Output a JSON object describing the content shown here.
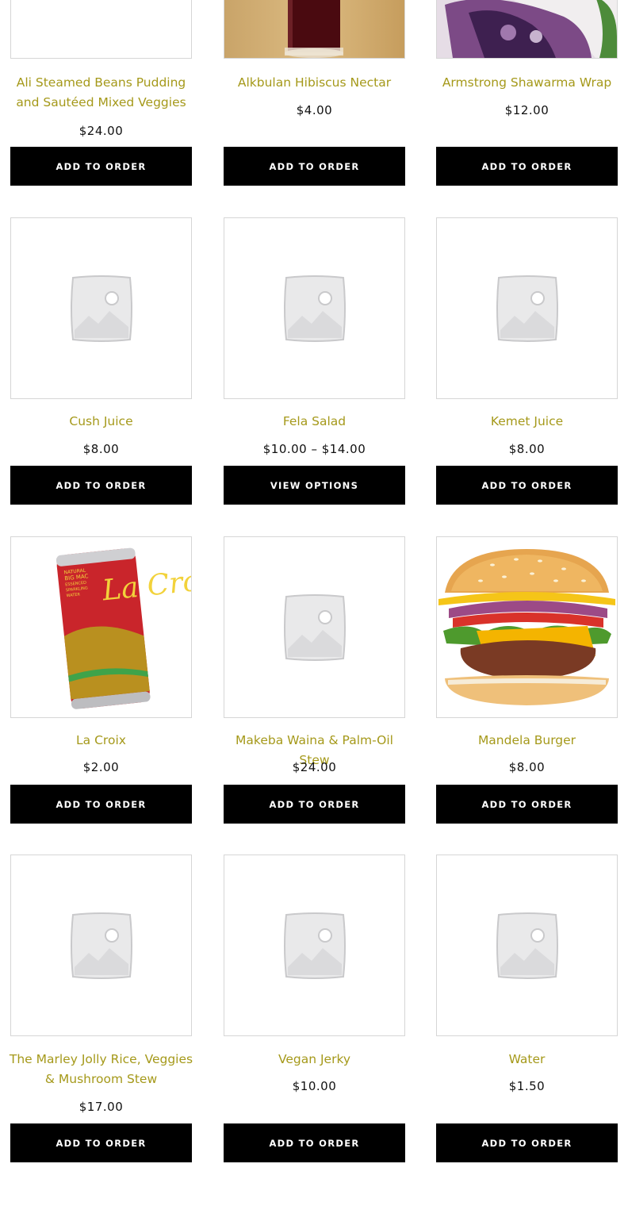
{
  "products": [
    {
      "name": "Ali Steamed Beans Pudding and Sautéed Mixed Veggies",
      "price": "$24.00",
      "button": "ADD TO ORDER",
      "image": "placeholder-image"
    },
    {
      "name": "Alkbulan Hibiscus Nectar",
      "price": "$4.00",
      "button": "ADD TO ORDER",
      "image": "glass-of-hibiscus-drink"
    },
    {
      "name": "Armstrong Shawarma Wrap",
      "price": "$12.00",
      "button": "ADD TO ORDER",
      "image": "wrap-photo"
    },
    {
      "name": "Cush Juice",
      "price": "$8.00",
      "button": "ADD TO ORDER",
      "image": "placeholder-image"
    },
    {
      "name": "Fela Salad",
      "price": "$10.00 – $14.00",
      "button": "VIEW OPTIONS",
      "image": "placeholder-image"
    },
    {
      "name": "Kemet Juice",
      "price": "$8.00",
      "button": "ADD TO ORDER",
      "image": "placeholder-image"
    },
    {
      "name": "La Croix",
      "price": "$2.00",
      "button": "ADD TO ORDER",
      "image": "la-croix-can",
      "image_text": {
        "brand": "La Croix",
        "line1": "NATURAL",
        "line2": "BIG MAC",
        "line3": "ESSENCED",
        "line4": "SPARKLING",
        "line5": "WATER"
      }
    },
    {
      "name": "Makeba Waina & Palm-Oil Stew",
      "price": "$24.00",
      "button": "ADD TO ORDER",
      "image": "placeholder-image"
    },
    {
      "name": "Mandela Burger",
      "price": "$8.00",
      "button": "ADD TO ORDER",
      "image": "burger-photo"
    },
    {
      "name": "The Marley Jolly Rice, Veggies & Mushroom Stew",
      "price": "$17.00",
      "button": "ADD TO ORDER",
      "image": "placeholder-image"
    },
    {
      "name": "Vegan Jerky",
      "price": "$10.00",
      "button": "ADD TO ORDER",
      "image": "placeholder-image"
    },
    {
      "name": "Water",
      "price": "$1.50",
      "button": "ADD TO ORDER",
      "image": "placeholder-image"
    }
  ],
  "colors": {
    "title": "#a5991a",
    "price": "#111111",
    "button_bg": "#000000",
    "button_text": "#ffffff",
    "border": "#d6d6d6"
  }
}
